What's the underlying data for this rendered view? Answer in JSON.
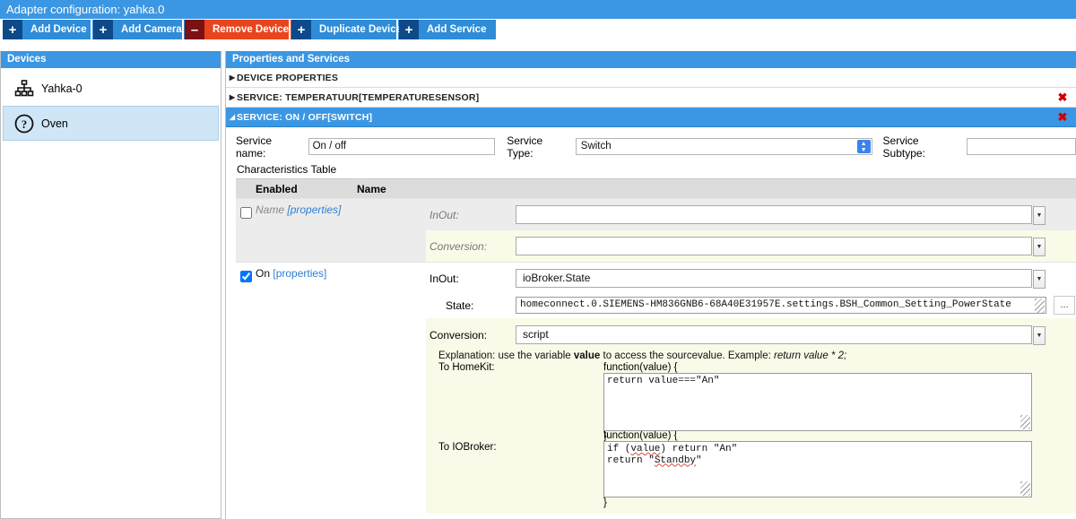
{
  "window": {
    "title": "Adapter configuration: yahka.0"
  },
  "toolbar": {
    "buttons": [
      {
        "icon": "plus-icon",
        "glyph": "+",
        "label": "Add Device",
        "style": "blue"
      },
      {
        "icon": "plus-icon",
        "glyph": "+",
        "label": "Add Camera",
        "style": "blue"
      },
      {
        "icon": "minus-icon",
        "glyph": "–",
        "label": "Remove Device",
        "style": "red"
      },
      {
        "icon": "plus-icon",
        "glyph": "+",
        "label": "Duplicate Device",
        "style": "blue"
      },
      {
        "icon": "plus-icon",
        "glyph": "+",
        "label": "Add Service",
        "style": "blue"
      }
    ]
  },
  "devices_panel": {
    "title": "Devices",
    "items": [
      {
        "label": "Yahka-0",
        "icon": "sitemap-icon",
        "selected": false
      },
      {
        "label": "Oven",
        "icon": "question-circle-icon",
        "selected": true
      }
    ]
  },
  "properties_panel": {
    "title": "Properties and Services",
    "accordion": [
      {
        "label": "DEVICE PROPERTIES",
        "expanded": false,
        "closable": false
      },
      {
        "label": "SERVICE: TEMPERATUUR[TEMPERATURESENSOR]",
        "expanded": false,
        "closable": true
      },
      {
        "label": "SERVICE: ON / OFF[SWITCH]",
        "expanded": true,
        "closable": true
      }
    ],
    "service_form": {
      "service_name_label": "Service name:",
      "service_name_value": "On / off",
      "service_type_label": "Service Type:",
      "service_type_value": "Switch",
      "service_subtype_label": "Service Subtype:",
      "service_subtype_value": "",
      "characteristics_title": "Characteristics Table"
    },
    "characteristics": {
      "headers": {
        "enabled": "Enabled",
        "name": "Name"
      },
      "rows": [
        {
          "enabled": false,
          "name": "Name",
          "properties_link": "[properties]",
          "inout_label": "InOut:",
          "inout_value": "",
          "conversion_label": "Conversion:",
          "conversion_value": ""
        },
        {
          "enabled": true,
          "name": "On",
          "properties_link": "[properties]",
          "inout_label": "InOut:",
          "inout_value": "ioBroker.State",
          "state_label": "State:",
          "state_value": "homeconnect.0.SIEMENS-HM836GNB6-68A40E31957E.settings.BSH_Common_Setting_PowerState",
          "state_browse_label": "...",
          "conversion_label": "Conversion:",
          "conversion_value": "script",
          "explanation_pre": "Explanation: use the variable ",
          "explanation_bold": "value",
          "explanation_mid": " to access the sourcevalue. Example: ",
          "explanation_ital": "return value * 2;",
          "to_homekit_label": "To HomeKit:",
          "to_homekit_fn_open": "function(value) {",
          "to_homekit_code_a": "return value===",
          "to_homekit_code_b": "\"An\"",
          "to_homekit_fn_close": "}",
          "to_iobroker_label": "To IOBroker:",
          "to_iobroker_fn_open": "function(value) {",
          "to_iobroker_code_l1a": "if (",
          "to_iobroker_code_l1b": "value",
          "to_iobroker_code_l1c": ") return \"An\"",
          "to_iobroker_code_l2a": "return \"",
          "to_iobroker_code_l2b": "Standby",
          "to_iobroker_code_l2c": "\"",
          "to_iobroker_fn_close": "}"
        }
      ]
    }
  },
  "icons": {
    "close": "✖",
    "caret_right": "▶",
    "caret_down": "◢",
    "arrow_down": "▼"
  },
  "colors": {
    "accent_blue": "#3b97e3",
    "toolbar_blue": "#2f8cd8",
    "toolbar_blue_dark": "#0e4a8a",
    "danger_red": "#e8441e",
    "danger_red_dark": "#7b1113",
    "close_x": "#cc0000",
    "selection": "#cfe6f7",
    "conversion_bg": "#fafae8",
    "inout_bg": "#ececec"
  }
}
